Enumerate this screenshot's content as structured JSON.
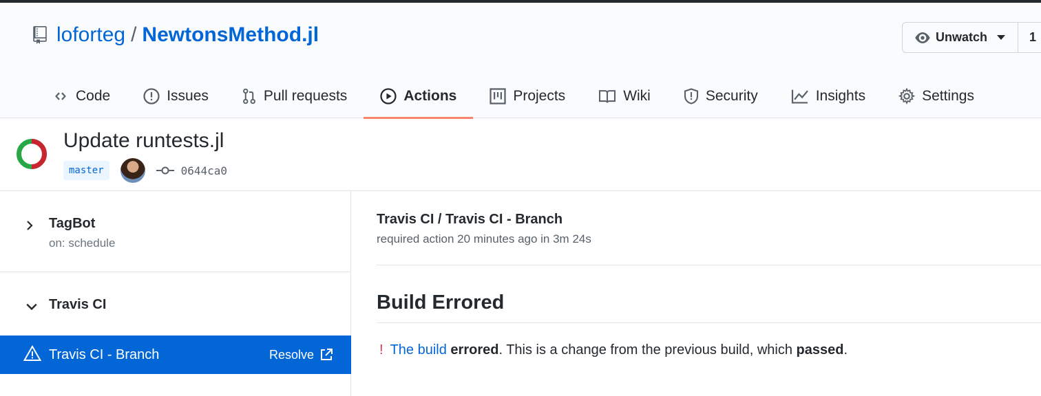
{
  "repo": {
    "owner": "loforteg",
    "separator": "/",
    "name": "NewtonsMethod.jl",
    "watch_label": "Unwatch",
    "watch_count": "1"
  },
  "tabs": [
    {
      "label": "Code",
      "icon": "code-icon"
    },
    {
      "label": "Issues",
      "icon": "issue-icon"
    },
    {
      "label": "Pull requests",
      "icon": "pull-request-icon"
    },
    {
      "label": "Actions",
      "icon": "play-icon",
      "active": true
    },
    {
      "label": "Projects",
      "icon": "project-icon"
    },
    {
      "label": "Wiki",
      "icon": "book-icon"
    },
    {
      "label": "Security",
      "icon": "shield-icon"
    },
    {
      "label": "Insights",
      "icon": "graph-icon"
    },
    {
      "label": "Settings",
      "icon": "gear-icon"
    }
  ],
  "run": {
    "title": "Update runtests.jl",
    "branch": "master",
    "commit": "0644ca0"
  },
  "sidebar": {
    "workflows": [
      {
        "name": "TagBot",
        "sub": "on: schedule",
        "collapsed": true
      },
      {
        "name": "Travis CI",
        "collapsed": false
      }
    ],
    "selected_job": {
      "name": "Travis CI - Branch",
      "action": "Resolve"
    }
  },
  "check": {
    "title": "Travis CI / Travis CI - Branch",
    "subtitle": "required action 20 minutes ago in 3m 24s",
    "build_title": "Build Errored",
    "msg_bang": "!",
    "msg_link": "The build",
    "msg_bold1": "errored",
    "msg_mid": ". This is a change from the previous build, which ",
    "msg_bold2": "passed",
    "msg_end": "."
  },
  "colors": {
    "link": "#0366d6",
    "active_tab": "#f9826c",
    "success": "#28a745",
    "failure": "#cb2431",
    "selected_bg": "#0366d6"
  }
}
